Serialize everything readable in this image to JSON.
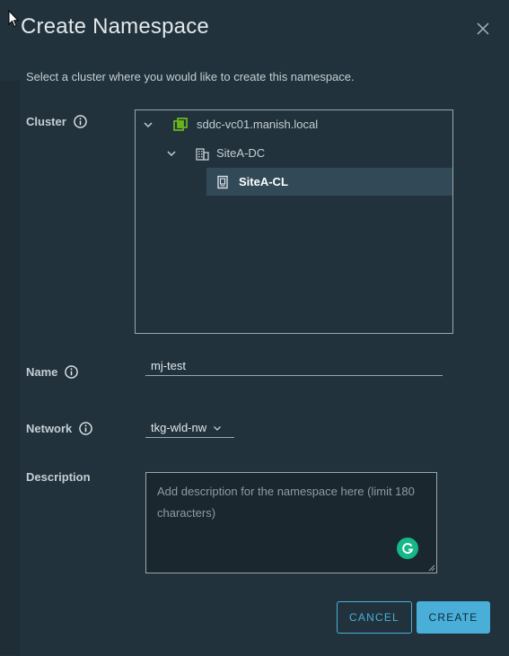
{
  "dialog": {
    "title": "Create Namespace",
    "subtitle": "Select a cluster where you would like to create this namespace."
  },
  "fields": {
    "cluster_label": "Cluster",
    "name_label": "Name",
    "network_label": "Network",
    "description_label": "Description"
  },
  "tree": {
    "items": [
      {
        "label": "sddc-vc01.manish.local",
        "icon": "vcenter-icon",
        "expanded": true
      },
      {
        "label": "SiteA-DC",
        "icon": "datacenter-icon",
        "expanded": true
      },
      {
        "label": "SiteA-CL",
        "icon": "cluster-icon",
        "selected": true
      }
    ]
  },
  "name": {
    "value": "mj-test"
  },
  "network": {
    "selected": "tkg-wld-nw"
  },
  "description": {
    "placeholder": "Add description for the namespace here (limit 180 characters)",
    "value": ""
  },
  "buttons": {
    "cancel": "CANCEL",
    "create": "CREATE"
  },
  "colors": {
    "accent": "#49afd9",
    "background": "#21323c",
    "selected_row": "#324a58",
    "vcenter_icon": "#6ab31f",
    "grammarly": "#15b886"
  }
}
